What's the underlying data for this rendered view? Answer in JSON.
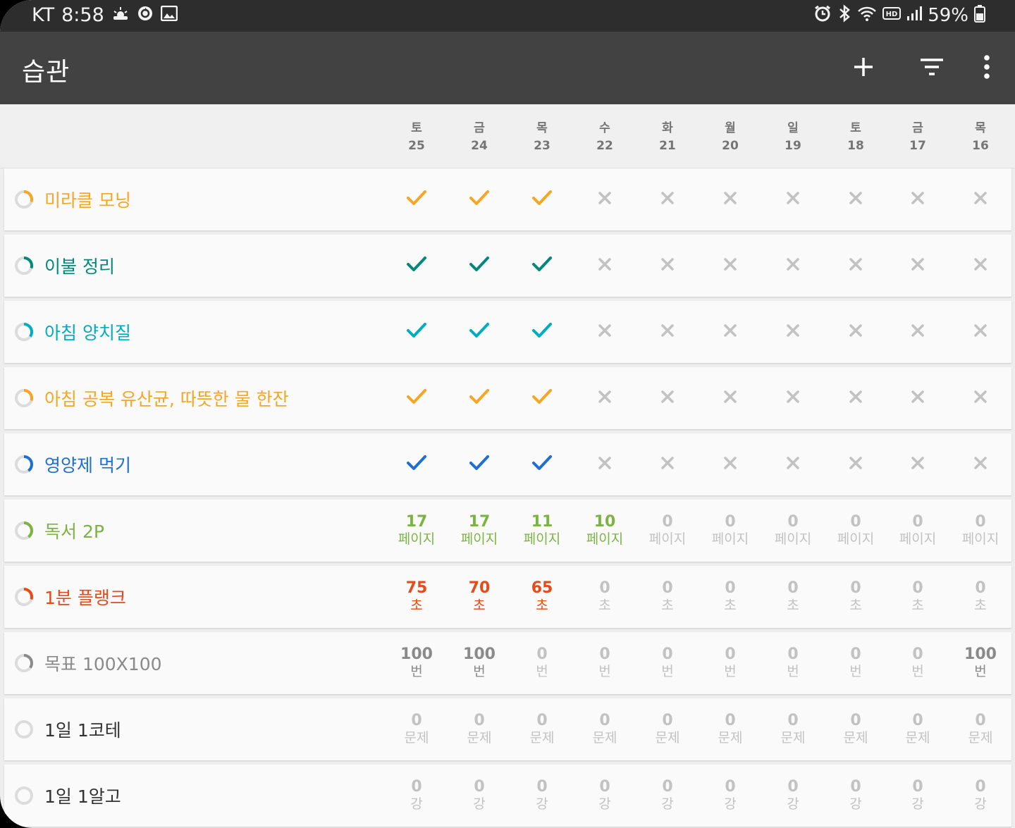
{
  "status_bar": {
    "carrier": "KT",
    "time": "8:58",
    "battery": "59%",
    "icons_left": [
      "weather-icon",
      "sync-icon",
      "image-icon"
    ],
    "icons_right": [
      "alarm-icon",
      "bluetooth-icon",
      "wifi-icon",
      "hd-icon",
      "signal-icon",
      "battery-icon"
    ]
  },
  "toolbar": {
    "title": "습관",
    "actions": [
      "add-icon",
      "filter-icon",
      "more-icon"
    ]
  },
  "colors": {
    "orange": "#f5a623",
    "teal": "#00897b",
    "cyan": "#00acc1",
    "blue": "#1e6fd0",
    "green": "#7cb342",
    "red": "#e64a19",
    "gray": "#8a8a8a",
    "inactive": "#c2c2c2"
  },
  "days": [
    {
      "weekday": "토",
      "day": "25"
    },
    {
      "weekday": "금",
      "day": "24"
    },
    {
      "weekday": "목",
      "day": "23"
    },
    {
      "weekday": "수",
      "day": "22"
    },
    {
      "weekday": "화",
      "day": "21"
    },
    {
      "weekday": "월",
      "day": "20"
    },
    {
      "weekday": "일",
      "day": "19"
    },
    {
      "weekday": "토",
      "day": "18"
    },
    {
      "weekday": "금",
      "day": "17"
    },
    {
      "weekday": "목",
      "day": "16"
    }
  ],
  "habits": [
    {
      "name": "미라클 모닝",
      "color": "#f5a623",
      "type": "check",
      "progress": 0.3,
      "values": [
        true,
        true,
        true,
        false,
        false,
        false,
        false,
        false,
        false,
        false
      ]
    },
    {
      "name": "이불 정리",
      "color": "#00897b",
      "type": "check",
      "progress": 0.3,
      "values": [
        true,
        true,
        true,
        false,
        false,
        false,
        false,
        false,
        false,
        false
      ]
    },
    {
      "name": "아침 양치질",
      "color": "#00acc1",
      "type": "check",
      "progress": 0.35,
      "values": [
        true,
        true,
        true,
        false,
        false,
        false,
        false,
        false,
        false,
        false
      ]
    },
    {
      "name": "아침 공복 유산균, 따뜻한 물 한잔",
      "color": "#f5a623",
      "type": "check",
      "progress": 0.3,
      "values": [
        true,
        true,
        true,
        false,
        false,
        false,
        false,
        false,
        false,
        false
      ]
    },
    {
      "name": "영양제 먹기",
      "color": "#1e6fd0",
      "type": "check",
      "progress": 0.4,
      "values": [
        true,
        true,
        true,
        false,
        false,
        false,
        false,
        false,
        false,
        false
      ]
    },
    {
      "name": "독서 2P",
      "color": "#7cb342",
      "type": "number",
      "unit": "페이지",
      "progress": 0.4,
      "values": [
        "17",
        "17",
        "11",
        "10",
        "0",
        "0",
        "0",
        "0",
        "0",
        "0"
      ]
    },
    {
      "name": "1분 플랭크",
      "color": "#e64a19",
      "type": "number",
      "unit": "초",
      "progress": 0.3,
      "values": [
        "75",
        "70",
        "65",
        "0",
        "0",
        "0",
        "0",
        "0",
        "0",
        "0"
      ]
    },
    {
      "name": "목표 100X100",
      "color": "#8a8a8a",
      "type": "number",
      "unit": "번",
      "progress": 0.35,
      "values": [
        "100",
        "100",
        "0",
        "0",
        "0",
        "0",
        "0",
        "0",
        "0",
        "100"
      ]
    },
    {
      "name": "1일 1코테",
      "color": "#333333",
      "type": "number",
      "unit": "문제",
      "progress": 0,
      "values": [
        "0",
        "0",
        "0",
        "0",
        "0",
        "0",
        "0",
        "0",
        "0",
        "0"
      ]
    },
    {
      "name": "1일 1알고",
      "color": "#333333",
      "type": "number",
      "unit": "강",
      "progress": 0,
      "values": [
        "0",
        "0",
        "0",
        "0",
        "0",
        "0",
        "0",
        "0",
        "0",
        "0"
      ]
    }
  ]
}
